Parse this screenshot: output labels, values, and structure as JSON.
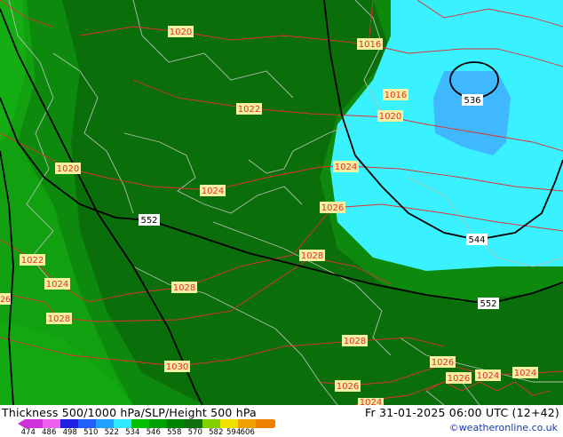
{
  "footer": {
    "title": "Thickness 500/1000 hPa/SLP/Height 500 hPa",
    "valid_time": "Fr 31-01-2025 06:00 UTC (12+42)",
    "credit": "©weatheronline.co.uk"
  },
  "legend": {
    "colors": [
      "#d030d8",
      "#f060f0",
      "#2020e0",
      "#2060f8",
      "#20a0ff",
      "#30e8ff",
      "#00c000",
      "#00a000",
      "#008000",
      "#107010",
      "#80d000",
      "#f0e000",
      "#f0a000",
      "#f08000"
    ],
    "ticks": [
      "474",
      "486",
      "498",
      "510",
      "522",
      "534",
      "546",
      "558",
      "570",
      "582",
      "594",
      "606"
    ]
  },
  "map": {
    "colors": {
      "dark_green": "#0a6e0a",
      "mid_green": "#0d8a0d",
      "light_green": "#10a010",
      "cyan": "#3af2ff",
      "blue": "#40b8ff",
      "isobar": "#e03030",
      "coast": "#b0c0b0",
      "height": "#000000"
    },
    "isobar_labels": [
      "1020",
      "1016",
      "1016",
      "1020",
      "1022",
      "1020",
      "1024",
      "1024",
      "1026",
      "1022",
      "1024",
      "1028",
      "1028",
      "1028",
      "1026",
      "1030",
      "1028",
      "1026",
      "1026",
      "1024",
      "1024",
      "1024",
      "1026"
    ],
    "height_labels": [
      "536",
      "544",
      "552",
      "552"
    ]
  }
}
